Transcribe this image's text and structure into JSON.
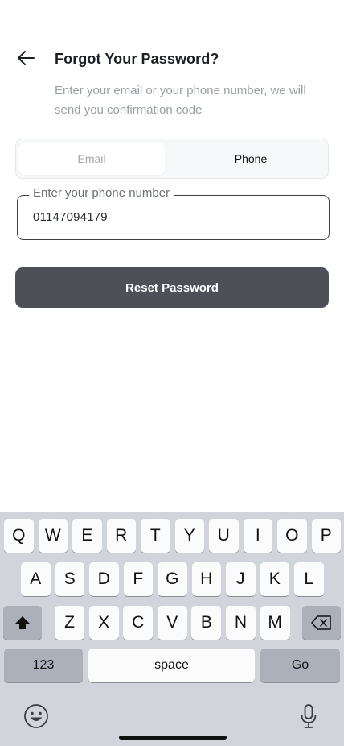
{
  "header": {
    "title": "Forgot Your Password?",
    "subtitle": "Enter your email or your phone number, we will send you confirmation code"
  },
  "tabs": {
    "email_label": "Email",
    "phone_label": "Phone",
    "selected": "Phone"
  },
  "phone_field": {
    "label": "Enter your phone number",
    "value": "01147094179"
  },
  "reset_button": {
    "label": "Reset Password"
  },
  "keyboard": {
    "row1": [
      "Q",
      "W",
      "E",
      "R",
      "T",
      "Y",
      "U",
      "I",
      "O",
      "P"
    ],
    "row2": [
      "A",
      "S",
      "D",
      "F",
      "G",
      "H",
      "J",
      "K",
      "L"
    ],
    "row3": [
      "Z",
      "X",
      "C",
      "V",
      "B",
      "N",
      "M"
    ],
    "numbers_label": "123",
    "space_label": "space",
    "go_label": "Go"
  },
  "colors": {
    "primary_button": "#4d5157",
    "keyboard_bg": "#d1d4da",
    "muted_text": "#9a9ea6"
  }
}
